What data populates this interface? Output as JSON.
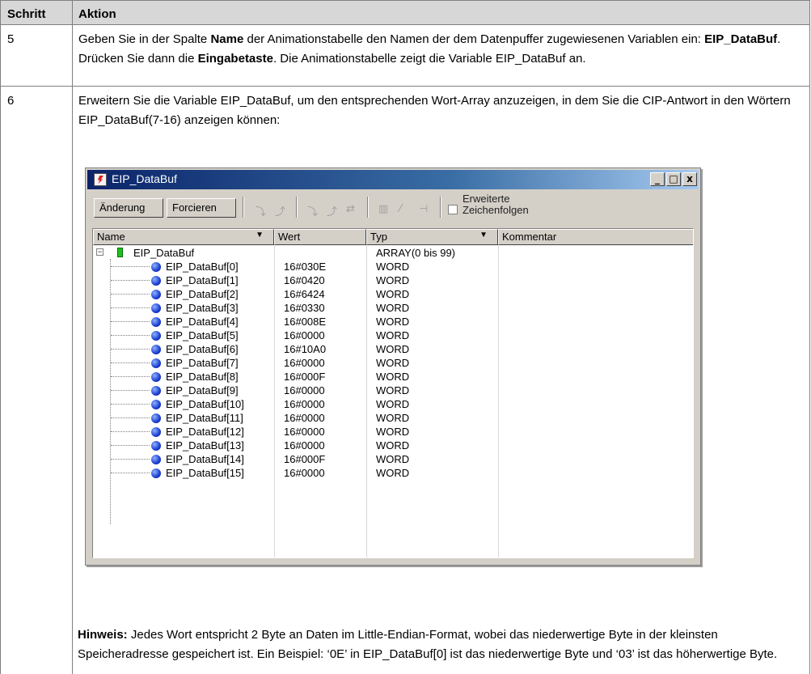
{
  "table": {
    "headers": [
      "Schritt",
      "Aktion"
    ],
    "step5": {
      "num": "5",
      "t1": "Geben Sie in der Spalte ",
      "b1": "Name",
      "t2": " der Animationstabelle den Namen der dem Datenpuffer zugewiesenen Variablen ein: ",
      "b2": "EIP_DataBuf",
      "t3": ". Drücken Sie dann die ",
      "b3": "Eingabetaste",
      "t4": ". Die Animationstabelle zeigt die Variable EIP_DataBuf an."
    },
    "step6": {
      "num": "6",
      "text": "Erweitern Sie die Variable EIP_DataBuf, um den entsprechenden Wort-Array anzuzeigen, in dem Sie die CIP-Antwort in den Wörtern EIP_DataBuf(7-16) anzeigen können:",
      "hint_label": "Hinweis:",
      "hint_text": " Jedes Wort entspricht 2 Byte an Daten im Little-Endian-Format, wobei das niederwertige Byte in der kleinsten Speicheradresse gespeichert ist. Ein Beispiel: ‘0E’ in EIP_DataBuf[0] ist das niederwertige Byte und ‘03’ ist das höherwertige Byte."
    }
  },
  "window": {
    "title": "EIP_DataBuf",
    "controls": {
      "minimize": "_",
      "maximize": "□",
      "close": "x"
    },
    "toolbar": {
      "modify_label": "Änderung",
      "force_label": "Forcieren",
      "extended_strings_label_1": "Erweiterte",
      "extended_strings_label_2": "Zeichenfolgen",
      "extended_strings_checked": false
    },
    "columns": [
      "Name",
      "Wert",
      "Typ",
      "Kommentar"
    ],
    "parent": {
      "name": "EIP_DataBuf",
      "value": "",
      "type": "ARRAY(0 bis 99)"
    },
    "rows": [
      {
        "name": "EIP_DataBuf[0]",
        "value": "16#030E",
        "type": "WORD"
      },
      {
        "name": "EIP_DataBuf[1]",
        "value": "16#0420",
        "type": "WORD"
      },
      {
        "name": "EIP_DataBuf[2]",
        "value": "16#6424",
        "type": "WORD"
      },
      {
        "name": "EIP_DataBuf[3]",
        "value": "16#0330",
        "type": "WORD"
      },
      {
        "name": "EIP_DataBuf[4]",
        "value": "16#008E",
        "type": "WORD"
      },
      {
        "name": "EIP_DataBuf[5]",
        "value": "16#0000",
        "type": "WORD"
      },
      {
        "name": "EIP_DataBuf[6]",
        "value": "16#10A0",
        "type": "WORD"
      },
      {
        "name": "EIP_DataBuf[7]",
        "value": "16#0000",
        "type": "WORD"
      },
      {
        "name": "EIP_DataBuf[8]",
        "value": "16#000F",
        "type": "WORD"
      },
      {
        "name": "EIP_DataBuf[9]",
        "value": "16#0000",
        "type": "WORD"
      },
      {
        "name": "EIP_DataBuf[10]",
        "value": "16#0000",
        "type": "WORD"
      },
      {
        "name": "EIP_DataBuf[11]",
        "value": "16#0000",
        "type": "WORD"
      },
      {
        "name": "EIP_DataBuf[12]",
        "value": "16#0000",
        "type": "WORD"
      },
      {
        "name": "EIP_DataBuf[13]",
        "value": "16#0000",
        "type": "WORD"
      },
      {
        "name": "EIP_DataBuf[14]",
        "value": "16#000F",
        "type": "WORD"
      },
      {
        "name": "EIP_DataBuf[15]",
        "value": "16#0000",
        "type": "WORD"
      }
    ]
  }
}
